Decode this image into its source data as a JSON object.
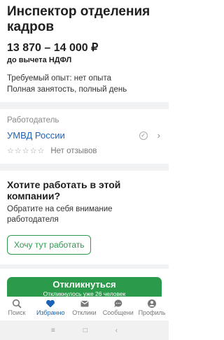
{
  "vacancy": {
    "title": "Инспектор отделения кадров",
    "salary": "13 870 – 14 000 ₽",
    "tax_note": "до вычета НДФЛ",
    "experience": "Требуемый опыт: нет опыта",
    "employment": "Полная занятость, полный день"
  },
  "employer": {
    "label": "Работодатель",
    "name": "УМВД России",
    "rating_stars": "☆☆☆☆☆",
    "reviews": "Нет отзывов"
  },
  "cta": {
    "title": "Хотите работать в этой компании?",
    "text": "Обратите на себя внимание работодателя",
    "button": "Хочу тут работать"
  },
  "respond": {
    "label": "Откликнуться",
    "sub": "Откликнулось уже 26 человек"
  },
  "tabs": [
    {
      "label": "Поиск",
      "icon": "search-icon"
    },
    {
      "label": "Избранно",
      "icon": "heart-icon"
    },
    {
      "label": "Отклики",
      "icon": "envelope-icon"
    },
    {
      "label": "Сообщени",
      "icon": "chat-icon"
    },
    {
      "label": "Профиль",
      "icon": "person-icon"
    }
  ],
  "system_nav": {
    "menu": "≡",
    "home": "□",
    "back": "‹"
  },
  "colors": {
    "accent_green": "#2b9a4a",
    "link_blue": "#1c63b8"
  }
}
